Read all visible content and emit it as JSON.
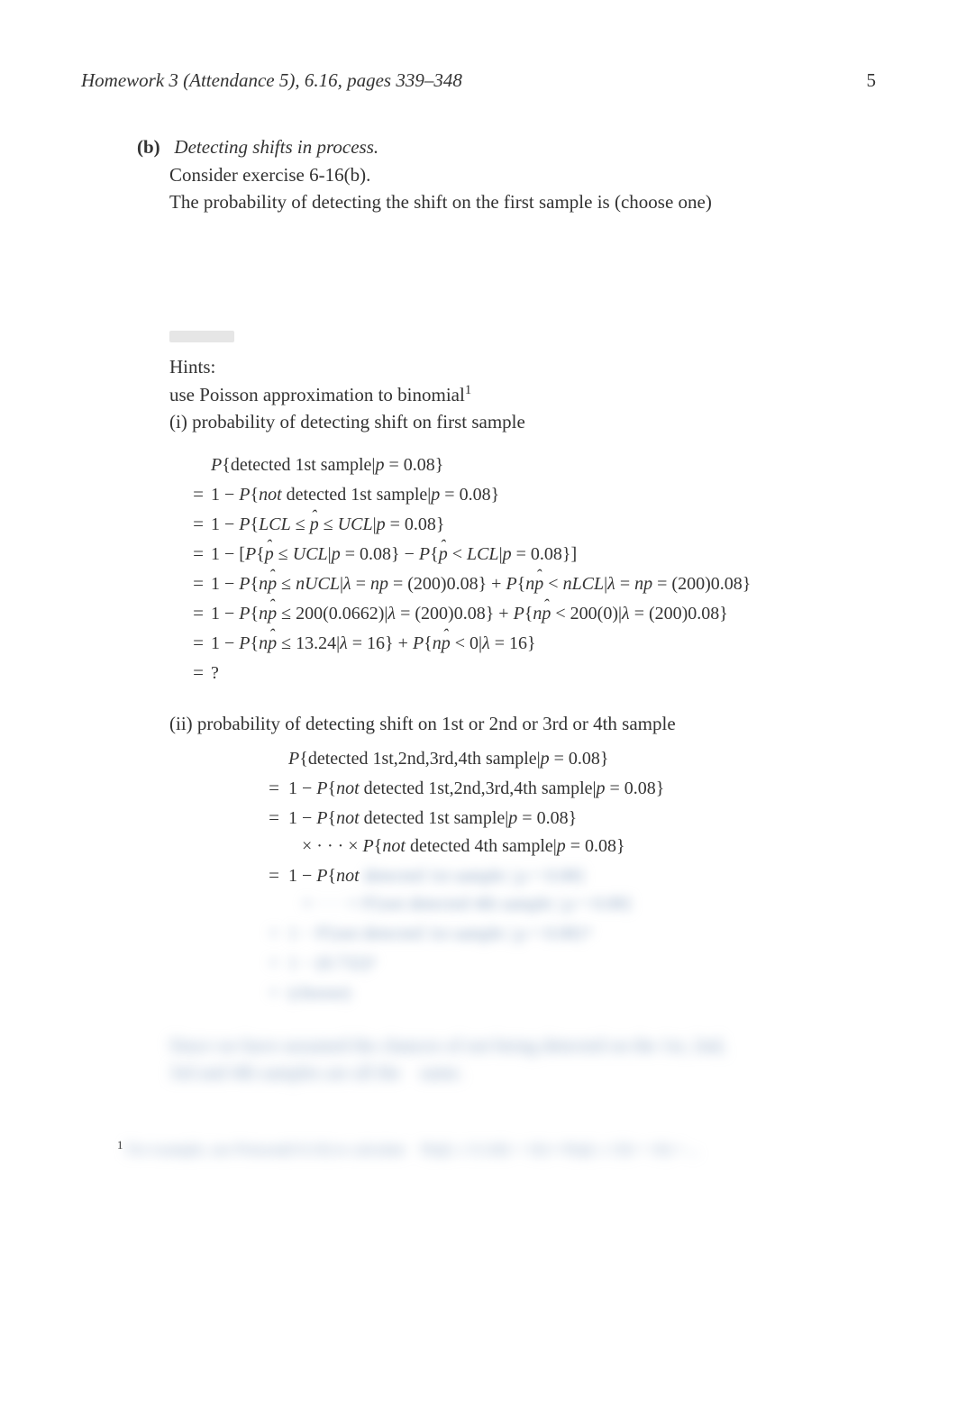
{
  "header": {
    "title": "Homework 3 (Attendance 5), 6.16, pages 339–348",
    "page_number": "5"
  },
  "item": {
    "label": "(b)",
    "title": "Detecting shifts in process.",
    "line1": "Consider exercise 6-16(b).",
    "line2": "The probability of detecting the shift on the first sample is (choose one)"
  },
  "hints": {
    "heading": "Hints:",
    "line1": "use Poisson approximation to binomial",
    "footnote_marker": "1",
    "line2": "(i) probability of detecting shift on first sample"
  },
  "math1": {
    "row0": "P{detected 1st sample|p = 0.08}",
    "row1": "1 − P{not detected 1st sample|p = 0.08}",
    "row2": "1 − P{LCL ≤ p̂ ≤ UCL|p = 0.08}",
    "row3": "1 − [P{p̂ ≤ UCL|p = 0.08} − P{p̂ < LCL|p = 0.08}]",
    "row4": "1 − P{np̂ ≤ nUCL|λ = np = (200)0.08} + P{np̂ < nLCL|λ = np = (200)0.08}",
    "row5": "1 − P{np̂ ≤ 200(0.0662)|λ = (200)0.08} + P{np̂ < 200(0)|λ = (200)0.08}",
    "row6": "1 − P{np̂ ≤ 13.24|λ = 16} + P{np̂ < 0|λ = 16}",
    "row7": "?"
  },
  "section2_label": "(ii) probability of detecting shift on 1st or 2nd or 3rd or 4th sample",
  "math2": {
    "row0": "P{detected 1st,2nd,3rd,4th sample|p = 0.08}",
    "row1": "1 − P{not detected 1st,2nd,3rd,4th sample|p = 0.08}",
    "row2": "1 − P{not detected 1st sample|p = 0.08}",
    "row2b": "× · · · × P{not detected 4th sample|p = 0.08}",
    "row3": "1 − P{not",
    "blur1": "detected 1st sample|p = 0.08}",
    "blur2": "× · · · × P{not detected 4th sample|p = 0.08}",
    "blur3": "× · · · × P{not detected 4th sample|p = 0.08}⁴",
    "blur4": "= 1 − (0.732)⁴",
    "blur5": "= (choose)"
  },
  "blurred_para": "Since we have assumed the chances of not being detected on the 1st, 2nd, 3rd and 4th samples are all the     same.",
  "footnote": "¹ For example, use Poisson(0.9,16) to calculate ... P(np̂ ≤ 13.24|λ = 16) ≈ P(np̂ ≤ 13|λ = 16) = ..."
}
